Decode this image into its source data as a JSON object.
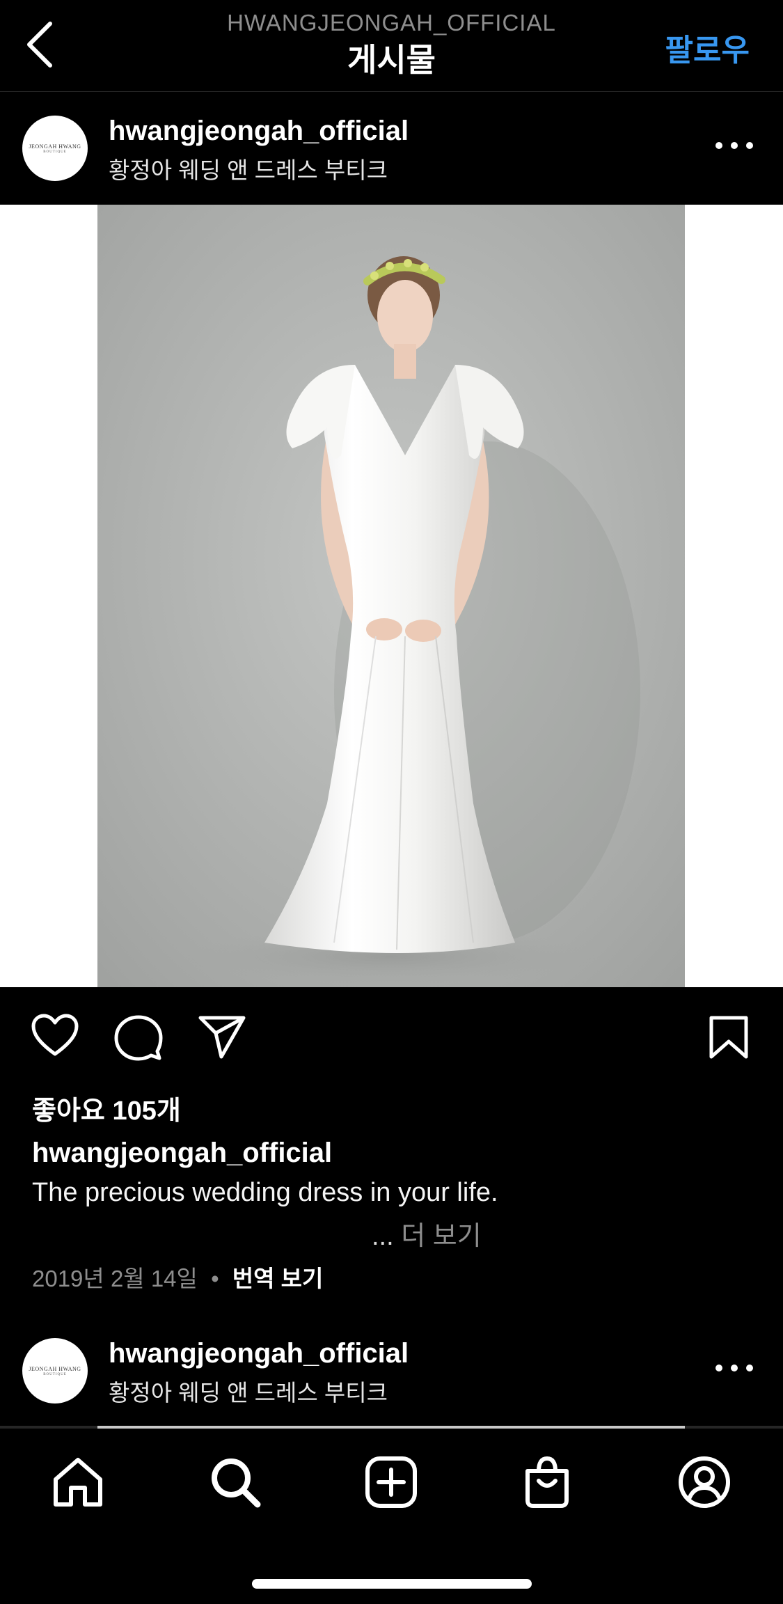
{
  "header": {
    "subtitle": "HWANGJEONGAH_OFFICIAL",
    "title": "게시물",
    "follow_label": "팔로우"
  },
  "post": {
    "username": "hwangjeongah_official",
    "subtitle": "황정아 웨딩 앤 드레스 부티크",
    "avatar_logo_line1": "JEONGAH HWANG",
    "avatar_logo_line2": "BOUTIQUE",
    "likes": "좋아요 105개",
    "caption_user": "hwangjeongah_official",
    "caption_text": "The precious wedding dress in your life.",
    "more_dots": "...",
    "more_label": "더 보기",
    "date": "2019년 2월 14일",
    "separator": "•",
    "translate_label": "번역 보기"
  },
  "next_post": {
    "username": "hwangjeongah_official",
    "subtitle": "황정아 웨딩 앤 드레스 부티크",
    "avatar_logo_line1": "JEONGAH HWANG",
    "avatar_logo_line2": "BOUTIQUE"
  },
  "icons": {
    "back": "chevron-left-icon",
    "more": "more-horizontal-icon",
    "like": "heart-icon",
    "comment": "comment-bubble-icon",
    "share": "paper-plane-icon",
    "save": "bookmark-icon",
    "home": "home-icon",
    "search": "search-icon",
    "create": "plus-square-icon",
    "shop": "shopping-bag-icon",
    "profile": "profile-icon"
  },
  "colors": {
    "background": "#000000",
    "accent": "#3897f0",
    "muted": "#8e8e8e"
  }
}
